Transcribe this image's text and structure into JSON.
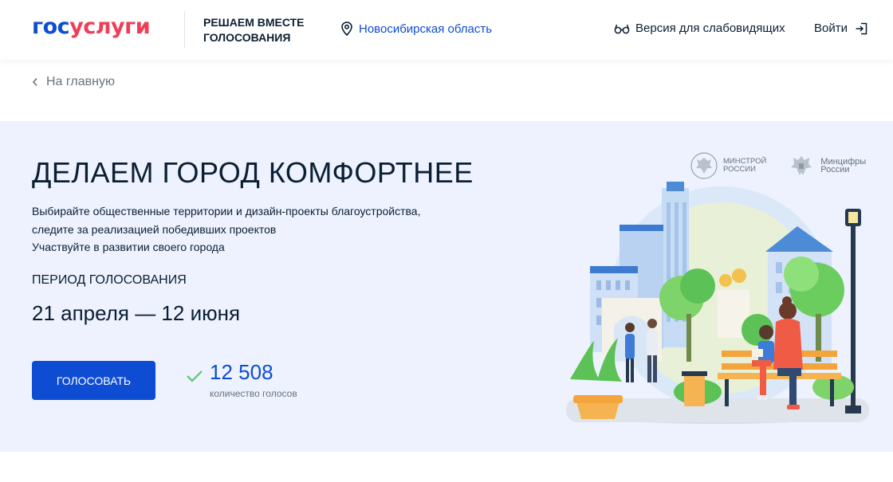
{
  "header": {
    "logo_part1": "гос",
    "logo_part2": "услуги",
    "slogan_line1": "РЕШАЕМ ВМЕСТЕ",
    "slogan_line2": "ГОЛОСОВАНИЯ",
    "region": "Новосибирская область",
    "vision_label": "Версия для слабовидящих",
    "login_label": "Войти"
  },
  "nav": {
    "back_label": "На главную"
  },
  "hero": {
    "title": "ДЕЛАЕМ ГОРОД КОМФОРТНЕЕ",
    "description_line1": "Выбирайте общественные территории и дизайн-проекты благоустройства,",
    "description_line2": "следите за реализацией победивших проектов",
    "description_line3": "Участвуйте в развитии своего города",
    "period_label": "ПЕРИОД ГОЛОСОВАНИЯ",
    "period_value": "21 апреля — 12 июня",
    "vote_button": "ГОЛОСОВАТЬ",
    "votes_count": "12 508",
    "votes_label": "количество голосов",
    "ministry1_line1": "МИНСТРОЙ",
    "ministry1_line2": "РОССИИ",
    "ministry2_line1": "Минцифры",
    "ministry2_line2": "России"
  },
  "icons": {
    "region": "map-pin-icon",
    "vision": "glasses-icon",
    "login": "login-icon",
    "back": "chevron-left-icon",
    "votes": "check-icon"
  },
  "colors": {
    "brand_blue": "#0d4cd3",
    "brand_red": "#ee3f58",
    "hero_bg": "#edf2fe",
    "text_secondary": "#66727f",
    "check_green": "#5ac869"
  }
}
